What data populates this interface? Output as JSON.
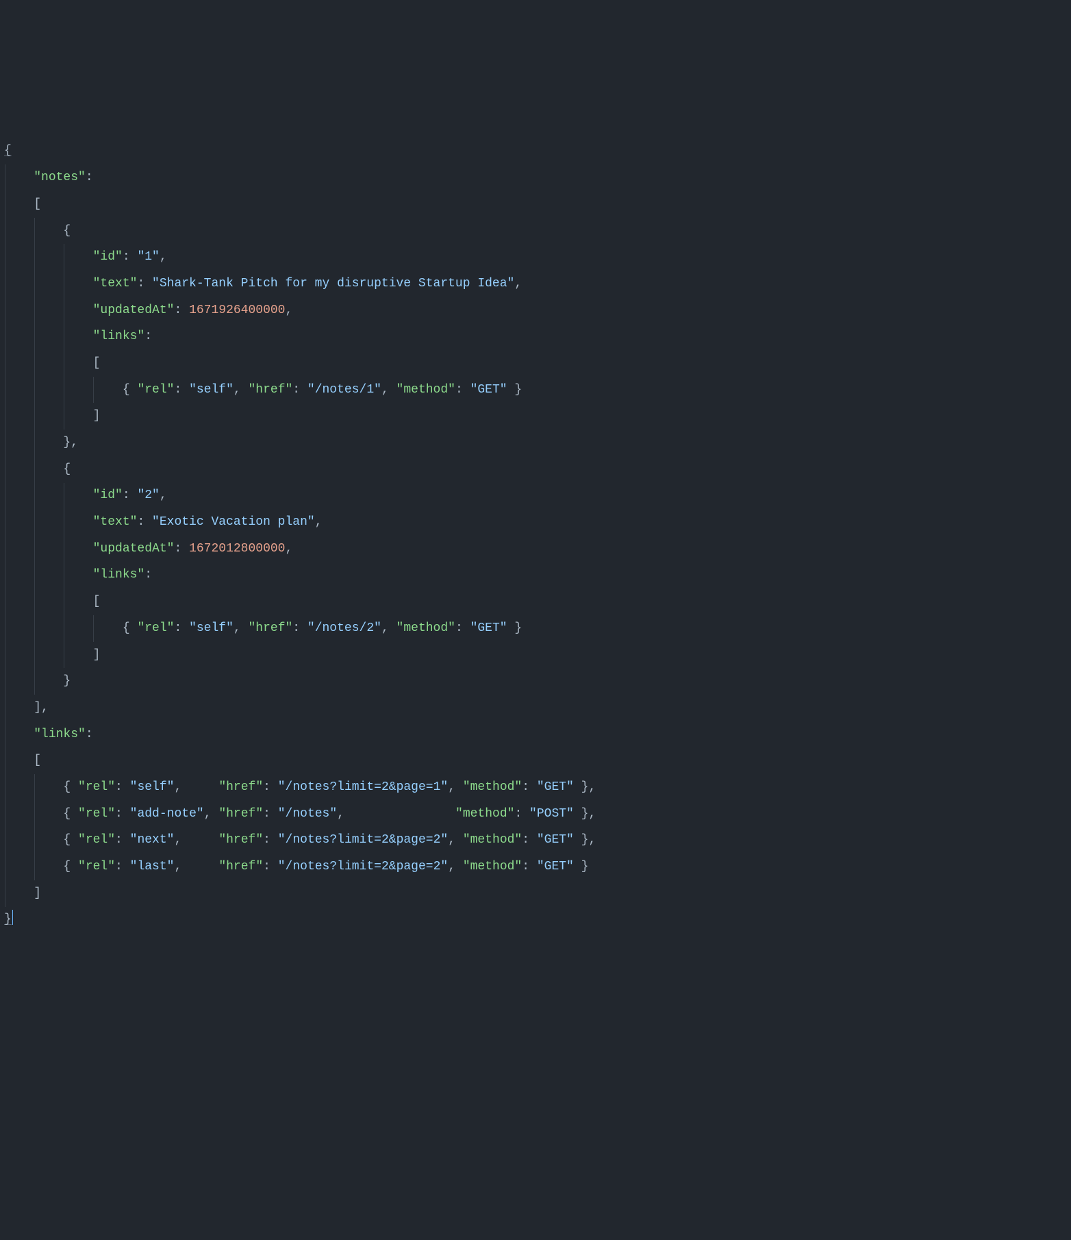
{
  "code": {
    "notesKey": "\"notes\"",
    "linksKey": "\"links\"",
    "idKey": "\"id\"",
    "textKey": "\"text\"",
    "updatedAtKey": "\"updatedAt\"",
    "relKey": "\"rel\"",
    "hrefKey": "\"href\"",
    "methodKey": "\"method\"",
    "note1": {
      "id": "\"1\"",
      "text": "\"Shark-Tank Pitch for my disruptive Startup Idea\"",
      "updatedAt": "1671926400000",
      "link": {
        "rel": "\"self\"",
        "href": "\"/notes/1\"",
        "method": "\"GET\""
      }
    },
    "note2": {
      "id": "\"2\"",
      "text": "\"Exotic Vacation plan\"",
      "updatedAt": "1672012800000",
      "link": {
        "rel": "\"self\"",
        "href": "\"/notes/2\"",
        "method": "\"GET\""
      }
    },
    "topLinks": [
      {
        "rel": "\"self\"",
        "href": "\"/notes?limit=2&page=1\"",
        "method": "\"GET\""
      },
      {
        "rel": "\"add-note\"",
        "href": "\"/notes\"",
        "method": "\"POST\""
      },
      {
        "rel": "\"next\"",
        "href": "\"/notes?limit=2&page=2\"",
        "method": "\"GET\""
      },
      {
        "rel": "\"last\"",
        "href": "\"/notes?limit=2&page=2\"",
        "method": "\"GET\""
      }
    ],
    "relPad": [
      "    ",
      "",
      "    ",
      "    "
    ],
    "hrefPad": [
      "",
      "              ",
      "",
      ""
    ]
  }
}
